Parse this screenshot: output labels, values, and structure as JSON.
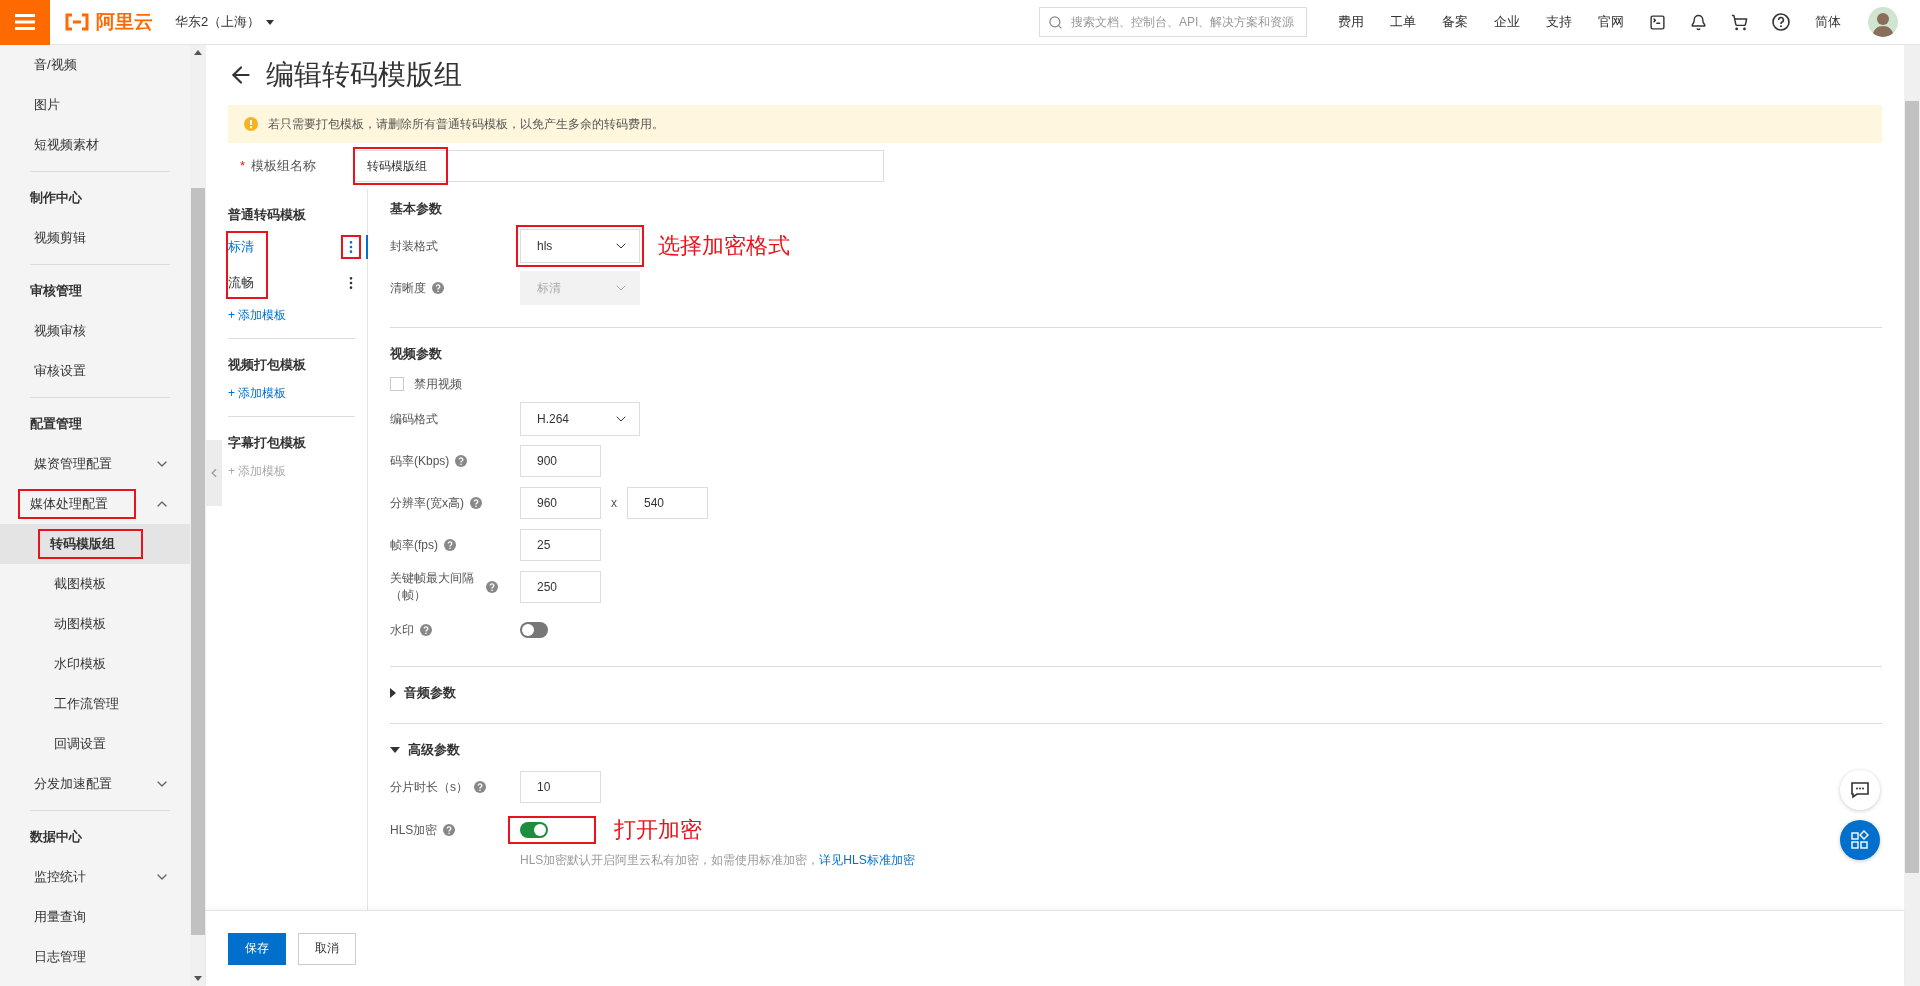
{
  "topbar": {
    "logo": "阿里云",
    "region": "华东2（上海）",
    "search": {
      "placeholder": "搜索文档、控制台、API、解决方案和资源"
    },
    "links": [
      "费用",
      "工单",
      "备案",
      "企业",
      "支持",
      "官网"
    ],
    "language": "简体"
  },
  "sidebar": {
    "sections": [
      {
        "items": [
          {
            "label": "音/视频",
            "kind": "link",
            "selected": false
          },
          {
            "label": "图片",
            "kind": "link",
            "selected": false
          },
          {
            "label": "短视频素材",
            "kind": "link",
            "selected": false
          }
        ]
      },
      {
        "title": "制作中心",
        "items": [
          {
            "label": "视频剪辑",
            "kind": "link",
            "selected": false
          }
        ]
      },
      {
        "title": "审核管理",
        "items": [
          {
            "label": "视频审核",
            "kind": "link",
            "selected": false
          },
          {
            "label": "审核设置",
            "kind": "link",
            "selected": false
          }
        ]
      },
      {
        "title": "配置管理",
        "items": [
          {
            "label": "媒资管理配置",
            "kind": "group",
            "expanded": false,
            "selected": false
          },
          {
            "label": "媒体处理配置",
            "kind": "group",
            "expanded": true,
            "selected": false,
            "annotated": true,
            "children": [
              {
                "label": "转码模版组",
                "selected": true,
                "annotated": true
              },
              {
                "label": "截图模板",
                "selected": false
              },
              {
                "label": "动图模板",
                "selected": false
              },
              {
                "label": "水印模板",
                "selected": false
              },
              {
                "label": "工作流管理",
                "selected": false
              },
              {
                "label": "回调设置",
                "selected": false
              }
            ]
          },
          {
            "label": "分发加速配置",
            "kind": "group",
            "expanded": false,
            "selected": false
          }
        ]
      },
      {
        "title": "数据中心",
        "items": [
          {
            "label": "监控统计",
            "kind": "group",
            "expanded": false,
            "selected": false
          },
          {
            "label": "用量查询",
            "kind": "link",
            "selected": false
          },
          {
            "label": "日志管理",
            "kind": "link",
            "selected": false
          }
        ]
      }
    ]
  },
  "page": {
    "title": "编辑转码模版组",
    "alert": "若只需要打包模板，请删除所有普通转码模板，以免产生多余的转码费用。",
    "name_field": {
      "required_mark": "*",
      "label": "模板组名称",
      "value": "转码模版组",
      "annotated": true
    }
  },
  "template_groups": [
    {
      "title": "普通转码模板",
      "items_annotated": true,
      "items": [
        {
          "label": "标清",
          "selected": true,
          "menu_annotated": true
        },
        {
          "label": "流畅",
          "selected": false,
          "menu_annotated": false
        }
      ],
      "add": {
        "label": "+ 添加模板",
        "disabled": false
      }
    },
    {
      "title": "视频打包模板",
      "add": {
        "label": "+ 添加模板",
        "disabled": false
      }
    },
    {
      "title": "字幕打包模板",
      "add": {
        "label": "+ 添加模板",
        "disabled": true
      }
    }
  ],
  "sections": [
    {
      "title": "基本参数",
      "fields": [
        {
          "kind": "select",
          "label": "封装格式",
          "value": "hls",
          "disabled": false,
          "annotated": true,
          "annotation": "选择加密格式"
        },
        {
          "kind": "select",
          "label": "清晰度",
          "value": "标清",
          "help": true,
          "disabled": true
        }
      ]
    },
    {
      "title": "视频参数",
      "fields": [
        {
          "kind": "checkbox",
          "label": "禁用视频",
          "checked": false
        },
        {
          "kind": "select",
          "label": "编码格式",
          "value": "H.264",
          "disabled": false
        },
        {
          "kind": "input",
          "label": "码率(Kbps)",
          "value": "900",
          "help": true
        },
        {
          "kind": "pair",
          "label": "分辨率(宽x高)",
          "values": [
            "960",
            "540"
          ],
          "separator": "x",
          "help": true
        },
        {
          "kind": "input",
          "label": "帧率(fps)",
          "value": "25",
          "help": true
        },
        {
          "kind": "input",
          "label": "关键帧最大间隔（帧）",
          "value": "250",
          "help": true
        },
        {
          "kind": "switch",
          "label": "水印",
          "on": false,
          "help": true
        }
      ]
    },
    {
      "title": "音频参数",
      "expanded": false
    },
    {
      "title": "高级参数",
      "expanded": true,
      "fields": [
        {
          "kind": "input",
          "label": "分片时长（s）",
          "value": "10",
          "help": true
        },
        {
          "kind": "switch",
          "label": "HLS加密",
          "on": true,
          "help": true,
          "annotated": true,
          "annotation": "打开加密",
          "hint": {
            "text": "HLS加密默认开启阿里云私有加密，如需使用标准加密，",
            "link": "详见HLS标准加密"
          }
        }
      ]
    }
  ],
  "footer": {
    "buttons": [
      {
        "label": "保存",
        "kind": "primary"
      },
      {
        "label": "取消",
        "kind": "default"
      }
    ]
  }
}
